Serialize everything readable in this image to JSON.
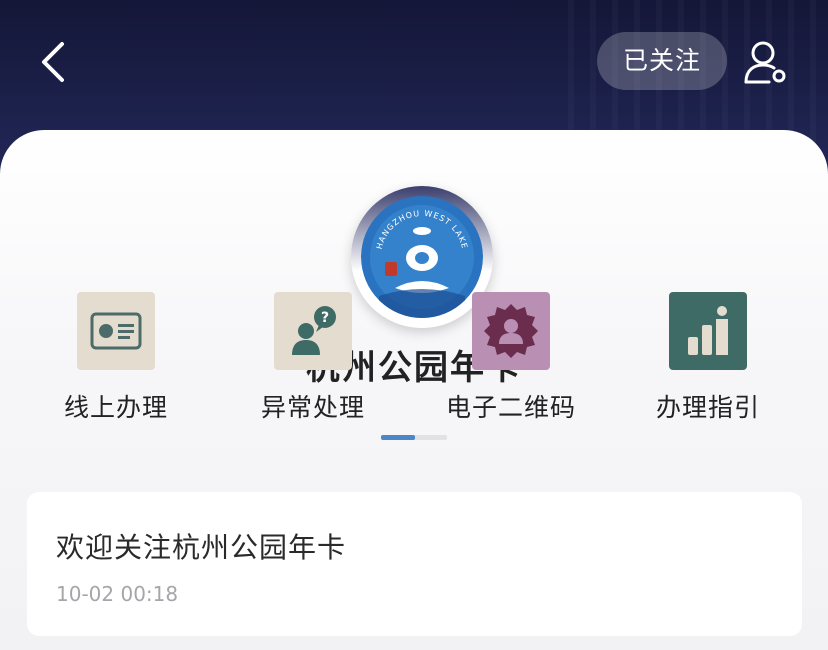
{
  "header": {
    "follow_label": "已关注",
    "background_color": "#1b1f47"
  },
  "account": {
    "name": "杭州公园年卡",
    "logo_text": "HANGZHOU WEST LAKE",
    "logo_color": "#2a73c0"
  },
  "menu": {
    "items": [
      {
        "label": "线上办理",
        "icon": "id-card-icon",
        "color": "#e4ddcf"
      },
      {
        "label": "异常处理",
        "icon": "user-question-icon",
        "color": "#e4ddcf"
      },
      {
        "label": "电子二维码",
        "icon": "badge-user-icon",
        "color": "#b98fb4"
      },
      {
        "label": "办理指引",
        "icon": "bar-chart-person-icon",
        "color": "#3f6b66"
      }
    ],
    "pager": {
      "pages": 2,
      "current": 1
    }
  },
  "messages": [
    {
      "title": "欢迎关注杭州公园年卡",
      "time": "10-02 00:18"
    }
  ]
}
